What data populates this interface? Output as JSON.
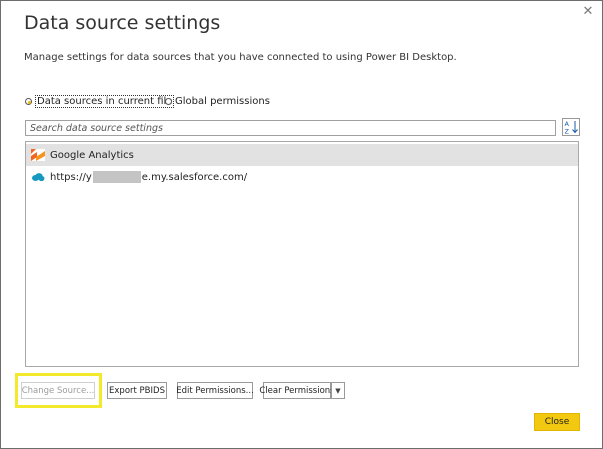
{
  "dialog": {
    "title": "Data source settings",
    "description": "Manage settings for data sources that you have connected to using Power BI Desktop.",
    "close_icon": "close-icon"
  },
  "scope": {
    "options": [
      {
        "label": "Data sources in current file",
        "selected": true
      },
      {
        "label": "Global permissions",
        "selected": false
      }
    ]
  },
  "search": {
    "placeholder": "Search data source settings",
    "value": "",
    "sort_icon": "sort-az-icon"
  },
  "sources": [
    {
      "label": "Google Analytics",
      "icon": "google-analytics-icon",
      "selected": true
    },
    {
      "label_prefix": "https://y",
      "label_suffix": "e.my.salesforce.com/",
      "redacted": true,
      "icon": "salesforce-cloud-icon",
      "selected": false
    }
  ],
  "actions": {
    "change_source": "Change Source...",
    "export_pbids": "Export PBIDS",
    "edit_permissions": "Edit Permissions...",
    "clear_permissions": "Clear Permissions",
    "dropdown_icon": "chevron-down-icon",
    "close": "Close"
  },
  "colors": {
    "accent": "#f2c811",
    "highlight": "#f2ea2a",
    "selected_row": "#e2e2e2",
    "google_analytics": "#f26522",
    "salesforce": "#1798c1"
  }
}
